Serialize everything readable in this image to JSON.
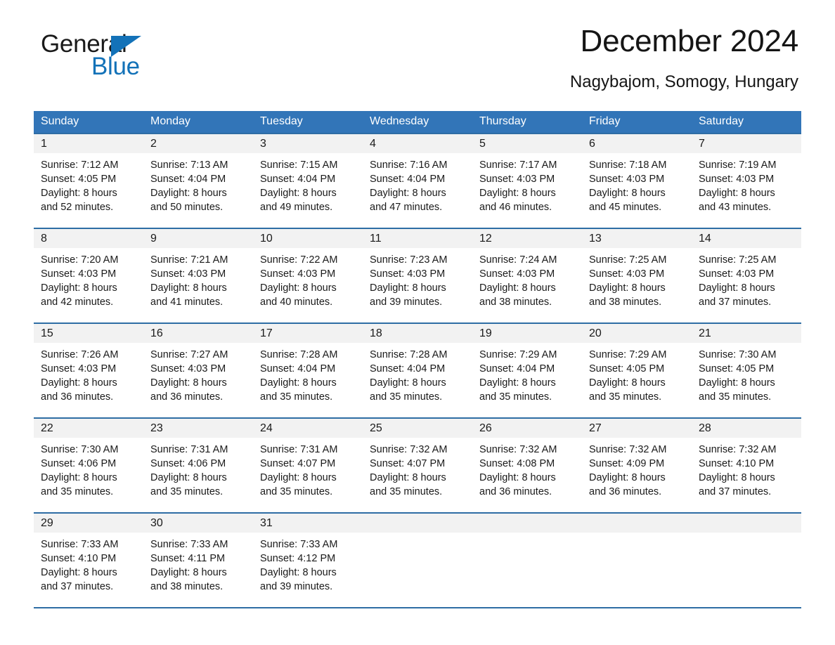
{
  "brand": {
    "word_general": "General",
    "word_blue": "Blue",
    "logo_icon": "general-blue-triangle-icon",
    "accent_color": "#1372b8"
  },
  "header": {
    "title": "December 2024",
    "subtitle": "Nagybajom, Somogy, Hungary"
  },
  "calendar": {
    "header_bg": "#3275b8",
    "row_divider": "#2e6da4",
    "daynum_bg": "#f2f2f2",
    "weekday_headers": [
      "Sunday",
      "Monday",
      "Tuesday",
      "Wednesday",
      "Thursday",
      "Friday",
      "Saturday"
    ],
    "weeks": [
      [
        {
          "day": "1",
          "sunrise": "Sunrise: 7:12 AM",
          "sunset": "Sunset: 4:05 PM",
          "daylight_line1": "Daylight: 8 hours",
          "daylight_line2": "and 52 minutes."
        },
        {
          "day": "2",
          "sunrise": "Sunrise: 7:13 AM",
          "sunset": "Sunset: 4:04 PM",
          "daylight_line1": "Daylight: 8 hours",
          "daylight_line2": "and 50 minutes."
        },
        {
          "day": "3",
          "sunrise": "Sunrise: 7:15 AM",
          "sunset": "Sunset: 4:04 PM",
          "daylight_line1": "Daylight: 8 hours",
          "daylight_line2": "and 49 minutes."
        },
        {
          "day": "4",
          "sunrise": "Sunrise: 7:16 AM",
          "sunset": "Sunset: 4:04 PM",
          "daylight_line1": "Daylight: 8 hours",
          "daylight_line2": "and 47 minutes."
        },
        {
          "day": "5",
          "sunrise": "Sunrise: 7:17 AM",
          "sunset": "Sunset: 4:03 PM",
          "daylight_line1": "Daylight: 8 hours",
          "daylight_line2": "and 46 minutes."
        },
        {
          "day": "6",
          "sunrise": "Sunrise: 7:18 AM",
          "sunset": "Sunset: 4:03 PM",
          "daylight_line1": "Daylight: 8 hours",
          "daylight_line2": "and 45 minutes."
        },
        {
          "day": "7",
          "sunrise": "Sunrise: 7:19 AM",
          "sunset": "Sunset: 4:03 PM",
          "daylight_line1": "Daylight: 8 hours",
          "daylight_line2": "and 43 minutes."
        }
      ],
      [
        {
          "day": "8",
          "sunrise": "Sunrise: 7:20 AM",
          "sunset": "Sunset: 4:03 PM",
          "daylight_line1": "Daylight: 8 hours",
          "daylight_line2": "and 42 minutes."
        },
        {
          "day": "9",
          "sunrise": "Sunrise: 7:21 AM",
          "sunset": "Sunset: 4:03 PM",
          "daylight_line1": "Daylight: 8 hours",
          "daylight_line2": "and 41 minutes."
        },
        {
          "day": "10",
          "sunrise": "Sunrise: 7:22 AM",
          "sunset": "Sunset: 4:03 PM",
          "daylight_line1": "Daylight: 8 hours",
          "daylight_line2": "and 40 minutes."
        },
        {
          "day": "11",
          "sunrise": "Sunrise: 7:23 AM",
          "sunset": "Sunset: 4:03 PM",
          "daylight_line1": "Daylight: 8 hours",
          "daylight_line2": "and 39 minutes."
        },
        {
          "day": "12",
          "sunrise": "Sunrise: 7:24 AM",
          "sunset": "Sunset: 4:03 PM",
          "daylight_line1": "Daylight: 8 hours",
          "daylight_line2": "and 38 minutes."
        },
        {
          "day": "13",
          "sunrise": "Sunrise: 7:25 AM",
          "sunset": "Sunset: 4:03 PM",
          "daylight_line1": "Daylight: 8 hours",
          "daylight_line2": "and 38 minutes."
        },
        {
          "day": "14",
          "sunrise": "Sunrise: 7:25 AM",
          "sunset": "Sunset: 4:03 PM",
          "daylight_line1": "Daylight: 8 hours",
          "daylight_line2": "and 37 minutes."
        }
      ],
      [
        {
          "day": "15",
          "sunrise": "Sunrise: 7:26 AM",
          "sunset": "Sunset: 4:03 PM",
          "daylight_line1": "Daylight: 8 hours",
          "daylight_line2": "and 36 minutes."
        },
        {
          "day": "16",
          "sunrise": "Sunrise: 7:27 AM",
          "sunset": "Sunset: 4:03 PM",
          "daylight_line1": "Daylight: 8 hours",
          "daylight_line2": "and 36 minutes."
        },
        {
          "day": "17",
          "sunrise": "Sunrise: 7:28 AM",
          "sunset": "Sunset: 4:04 PM",
          "daylight_line1": "Daylight: 8 hours",
          "daylight_line2": "and 35 minutes."
        },
        {
          "day": "18",
          "sunrise": "Sunrise: 7:28 AM",
          "sunset": "Sunset: 4:04 PM",
          "daylight_line1": "Daylight: 8 hours",
          "daylight_line2": "and 35 minutes."
        },
        {
          "day": "19",
          "sunrise": "Sunrise: 7:29 AM",
          "sunset": "Sunset: 4:04 PM",
          "daylight_line1": "Daylight: 8 hours",
          "daylight_line2": "and 35 minutes."
        },
        {
          "day": "20",
          "sunrise": "Sunrise: 7:29 AM",
          "sunset": "Sunset: 4:05 PM",
          "daylight_line1": "Daylight: 8 hours",
          "daylight_line2": "and 35 minutes."
        },
        {
          "day": "21",
          "sunrise": "Sunrise: 7:30 AM",
          "sunset": "Sunset: 4:05 PM",
          "daylight_line1": "Daylight: 8 hours",
          "daylight_line2": "and 35 minutes."
        }
      ],
      [
        {
          "day": "22",
          "sunrise": "Sunrise: 7:30 AM",
          "sunset": "Sunset: 4:06 PM",
          "daylight_line1": "Daylight: 8 hours",
          "daylight_line2": "and 35 minutes."
        },
        {
          "day": "23",
          "sunrise": "Sunrise: 7:31 AM",
          "sunset": "Sunset: 4:06 PM",
          "daylight_line1": "Daylight: 8 hours",
          "daylight_line2": "and 35 minutes."
        },
        {
          "day": "24",
          "sunrise": "Sunrise: 7:31 AM",
          "sunset": "Sunset: 4:07 PM",
          "daylight_line1": "Daylight: 8 hours",
          "daylight_line2": "and 35 minutes."
        },
        {
          "day": "25",
          "sunrise": "Sunrise: 7:32 AM",
          "sunset": "Sunset: 4:07 PM",
          "daylight_line1": "Daylight: 8 hours",
          "daylight_line2": "and 35 minutes."
        },
        {
          "day": "26",
          "sunrise": "Sunrise: 7:32 AM",
          "sunset": "Sunset: 4:08 PM",
          "daylight_line1": "Daylight: 8 hours",
          "daylight_line2": "and 36 minutes."
        },
        {
          "day": "27",
          "sunrise": "Sunrise: 7:32 AM",
          "sunset": "Sunset: 4:09 PM",
          "daylight_line1": "Daylight: 8 hours",
          "daylight_line2": "and 36 minutes."
        },
        {
          "day": "28",
          "sunrise": "Sunrise: 7:32 AM",
          "sunset": "Sunset: 4:10 PM",
          "daylight_line1": "Daylight: 8 hours",
          "daylight_line2": "and 37 minutes."
        }
      ],
      [
        {
          "day": "29",
          "sunrise": "Sunrise: 7:33 AM",
          "sunset": "Sunset: 4:10 PM",
          "daylight_line1": "Daylight: 8 hours",
          "daylight_line2": "and 37 minutes."
        },
        {
          "day": "30",
          "sunrise": "Sunrise: 7:33 AM",
          "sunset": "Sunset: 4:11 PM",
          "daylight_line1": "Daylight: 8 hours",
          "daylight_line2": "and 38 minutes."
        },
        {
          "day": "31",
          "sunrise": "Sunrise: 7:33 AM",
          "sunset": "Sunset: 4:12 PM",
          "daylight_line1": "Daylight: 8 hours",
          "daylight_line2": "and 39 minutes."
        },
        {
          "day": "",
          "sunrise": "",
          "sunset": "",
          "daylight_line1": "",
          "daylight_line2": ""
        },
        {
          "day": "",
          "sunrise": "",
          "sunset": "",
          "daylight_line1": "",
          "daylight_line2": ""
        },
        {
          "day": "",
          "sunrise": "",
          "sunset": "",
          "daylight_line1": "",
          "daylight_line2": ""
        },
        {
          "day": "",
          "sunrise": "",
          "sunset": "",
          "daylight_line1": "",
          "daylight_line2": ""
        }
      ]
    ]
  }
}
